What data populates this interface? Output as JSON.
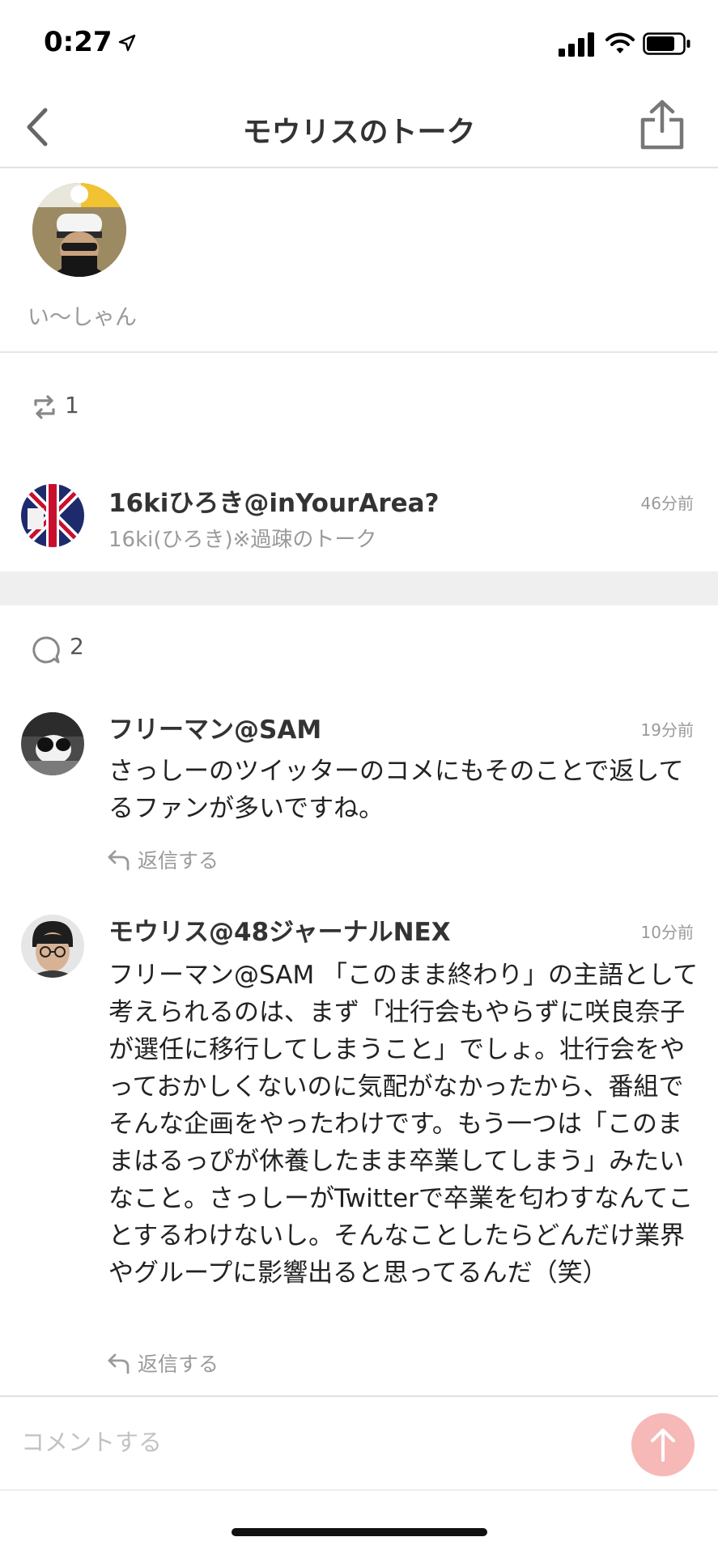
{
  "status_bar": {
    "time": "0:27"
  },
  "header": {
    "title": "モウリスのトーク"
  },
  "author": {
    "name": "い〜しゃん"
  },
  "retweets": {
    "count": "1",
    "items": [
      {
        "name": "16kiひろき@inYourArea?",
        "subtitle": "16ki(ひろき)※過疎のトーク",
        "time": "46分前"
      }
    ]
  },
  "comments": {
    "count": "2",
    "items": [
      {
        "author": "フリーマン@SAM",
        "time": "19分前",
        "body": "さっしーのツイッターのコメにもそのことで返してるファンが多いですね。",
        "reply_label": "返信する"
      },
      {
        "author": "モウリス@48ジャーナルNEX",
        "time": "10分前",
        "body": "フリーマン@SAM 「このまま終わり」の主語として考えられるのは、まず「壮行会もやらずに咲良奈子が選任に移行してしまうこと」でしょ。壮行会をやっておかしくないのに気配がなかったから、番組でそんな企画をやったわけです。もう一つは「このままはるっぴが休養したまま卒業してしまう」みたいなこと。さっしーがTwitterで卒業を匂わすなんてことするわけないし。そんなことしたらどんだけ業界やグループに影響出ると思ってるんだ（笑）",
        "reply_label": "返信する"
      }
    ]
  },
  "input": {
    "placeholder": "コメントする"
  },
  "colors": {
    "send_button": "#f7b8b8",
    "separator": "#efefef",
    "muted_text": "#9a9a9a"
  }
}
